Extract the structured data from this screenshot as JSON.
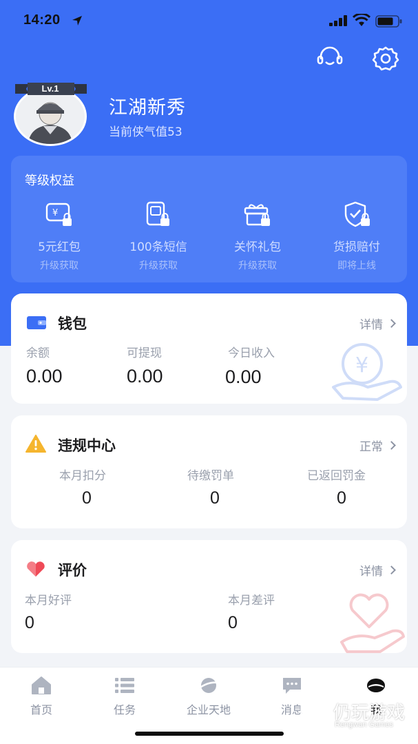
{
  "status_bar": {
    "time": "14:20"
  },
  "profile": {
    "level": "Lv.1",
    "nickname": "江湖新秀",
    "chivalry": "当前侠气值53"
  },
  "benefits": {
    "title": "等级权益",
    "items": [
      {
        "icon": "red-packet-lock-icon",
        "name": "5元红包",
        "status": "升级获取"
      },
      {
        "icon": "sms-lock-icon",
        "name": "100条短信",
        "status": "升级获取"
      },
      {
        "icon": "gift-lock-icon",
        "name": "关怀礼包",
        "status": "升级获取"
      },
      {
        "icon": "shield-check-icon",
        "name": "货损赔付",
        "status": "即将上线"
      }
    ]
  },
  "wallet": {
    "title": "钱包",
    "link": "详情",
    "stats": [
      {
        "label": "余额",
        "value": "0.00"
      },
      {
        "label": "可提现",
        "value": "0.00"
      },
      {
        "label": "今日收入",
        "value": "0.00"
      }
    ]
  },
  "violation": {
    "title": "违规中心",
    "link": "正常",
    "stats": [
      {
        "label": "本月扣分",
        "value": "0"
      },
      {
        "label": "待缴罚单",
        "value": "0"
      },
      {
        "label": "已返回罚金",
        "value": "0"
      }
    ]
  },
  "review": {
    "title": "评价",
    "link": "详情",
    "stats": [
      {
        "label": "本月好评",
        "value": "0"
      },
      {
        "label": "本月差评",
        "value": "0"
      }
    ]
  },
  "tabbar": {
    "items": [
      {
        "label": "首页",
        "icon": "home-icon"
      },
      {
        "label": "任务",
        "icon": "list-icon"
      },
      {
        "label": "企业天地",
        "icon": "planet-icon"
      },
      {
        "label": "消息",
        "icon": "chat-icon"
      },
      {
        "label": "我",
        "icon": "profile-icon",
        "active": true
      }
    ]
  },
  "watermark": {
    "main": "仍玩游戏",
    "sub": "Rengwan Games"
  },
  "colors": {
    "primary": "#3b6ef5",
    "benefit_card": "#4f7ef7",
    "warning": "#f5b52e",
    "heart": "#ef4a57"
  }
}
